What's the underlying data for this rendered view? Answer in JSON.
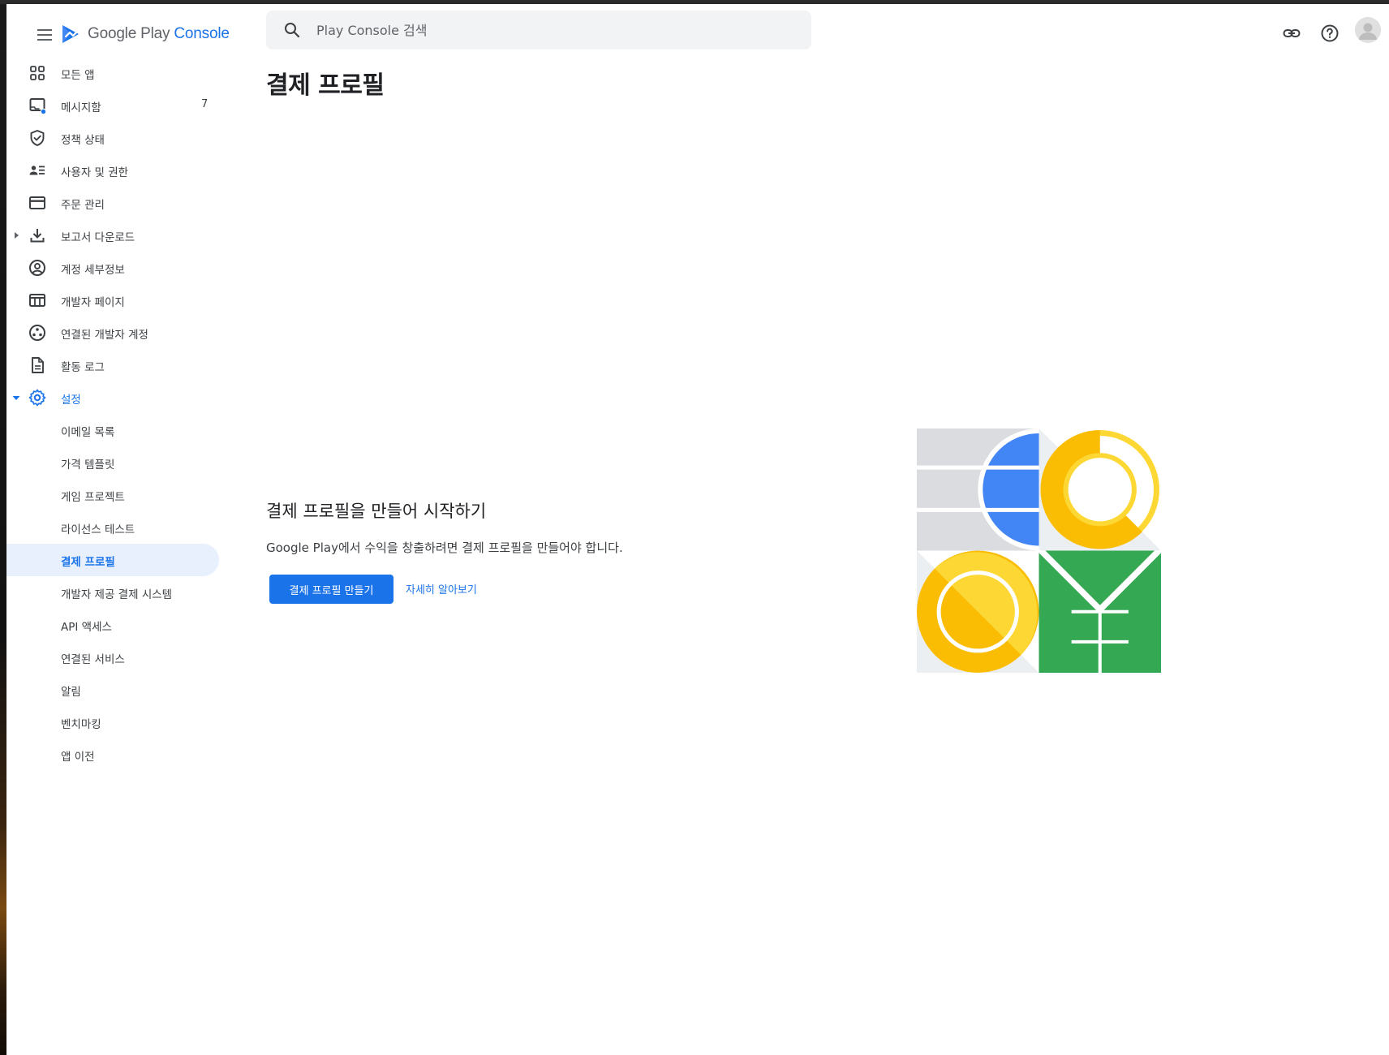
{
  "header": {
    "logo_google_play": "Google Play",
    "logo_console": "Console",
    "search_placeholder": "Play Console 검색"
  },
  "icons": {
    "menu": "menu-icon",
    "search": "search-icon",
    "link": "link-icon",
    "help": "help-icon",
    "avatar": "account-avatar"
  },
  "sidebar": {
    "items": [
      {
        "label": "모든 앱",
        "icon": "grid-icon"
      },
      {
        "label": "메시지함",
        "icon": "inbox-icon",
        "badge": "7"
      },
      {
        "label": "정책 상태",
        "icon": "shield-check-icon"
      },
      {
        "label": "사용자 및 권한",
        "icon": "users-list-icon"
      },
      {
        "label": "주문 관리",
        "icon": "credit-card-icon"
      },
      {
        "label": "보고서 다운로드",
        "icon": "download-icon"
      },
      {
        "label": "계정 세부정보",
        "icon": "account-circle-icon"
      },
      {
        "label": "개발자 페이지",
        "icon": "web-page-icon"
      },
      {
        "label": "연결된 개발자 계정",
        "icon": "linked-accounts-icon"
      },
      {
        "label": "활동 로그",
        "icon": "document-icon"
      },
      {
        "label": "설정",
        "icon": "gear-icon"
      }
    ],
    "settings_sub": [
      {
        "label": "이메일 목록"
      },
      {
        "label": "가격 템플릿"
      },
      {
        "label": "게임 프로젝트"
      },
      {
        "label": "라이선스 테스트"
      },
      {
        "label": "결제 프로필"
      },
      {
        "label": "개발자 제공 결제 시스템"
      },
      {
        "label": "API 액세스"
      },
      {
        "label": "연결된 서비스"
      },
      {
        "label": "알림"
      },
      {
        "label": "벤치마킹"
      },
      {
        "label": "앱 이전"
      }
    ]
  },
  "main": {
    "page_title": "결제 프로필",
    "empty_title": "결제 프로필을 만들어 시작하기",
    "empty_description": "Google Play에서 수익을 창출하려면 결제 프로필을 만들어야 합니다.",
    "create_button": "결제 프로필 만들기",
    "learn_more": "자세히 알아보기"
  },
  "colors": {
    "accent": "#1a73e8",
    "active_nav_bg": "#e8f0fe",
    "illustration_blue": "#4285f4",
    "illustration_yellow": "#fbbc04",
    "illustration_green": "#34a853",
    "illustration_gray": "#dadce0"
  }
}
